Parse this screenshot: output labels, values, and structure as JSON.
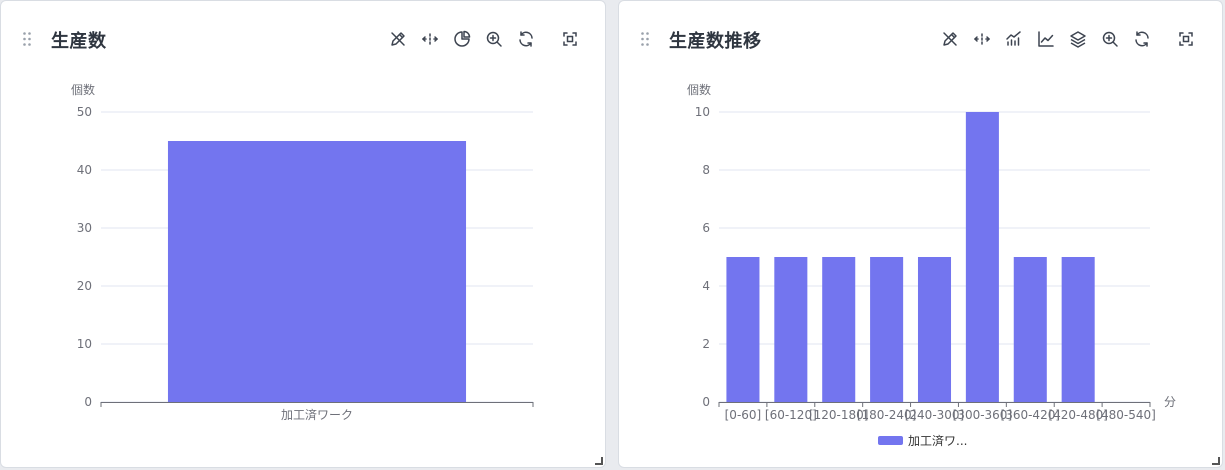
{
  "colors": {
    "bar": "#7375ef",
    "axis": "#6e7079",
    "grid": "#e0e6f1"
  },
  "panels": [
    {
      "title": "生産数",
      "tools": [
        "edit-icon",
        "move-icon",
        "pie-chart-icon",
        "zoom-in-icon",
        "refresh-icon",
        "fullscreen-icon"
      ]
    },
    {
      "title": "生産数推移",
      "tools": [
        "edit-icon",
        "move-icon",
        "bar-line-chart-icon",
        "line-chart-icon",
        "layers-icon",
        "zoom-in-icon",
        "refresh-icon",
        "fullscreen-icon"
      ]
    }
  ],
  "chart_data": [
    {
      "type": "bar",
      "categories": [
        "加工済ワーク"
      ],
      "values": [
        45
      ],
      "ylabel": "個数",
      "xlabel": "",
      "ylim": [
        0,
        50
      ],
      "yticks": [
        0,
        10,
        20,
        30,
        40,
        50
      ],
      "grid": true,
      "legend": null
    },
    {
      "type": "bar",
      "categories": [
        "[0-60]",
        "[60-120]",
        "[120-180]",
        "[180-240]",
        "[240-300]",
        "[300-360]",
        "[360-420]",
        "[420-480]",
        "[480-540]"
      ],
      "series": [
        {
          "name": "加工済ワ...",
          "values": [
            5,
            5,
            5,
            5,
            5,
            10,
            5,
            5,
            0
          ]
        }
      ],
      "ylabel": "個数",
      "xlabel": "分",
      "ylim": [
        0,
        10
      ],
      "yticks": [
        0,
        2,
        4,
        6,
        8,
        10
      ],
      "grid": true,
      "legend": "bottom-center"
    }
  ]
}
